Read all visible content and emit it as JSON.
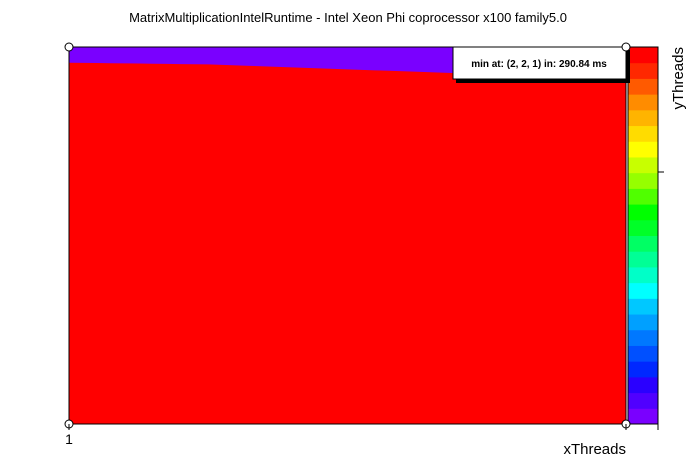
{
  "chart_data": {
    "type": "heatmap",
    "title": "MatrixMultiplicationIntelRuntime - Intel Xeon Phi coprocessor x100 family5.0",
    "xlabel": "xThreads",
    "ylabel": "yThreads",
    "x_ticks": [
      "1"
    ],
    "info_box": "min at: (2, 2, 1) in: 290.84 ms",
    "contour_levels": 20,
    "palette": [
      "#7a00ff",
      "#5000ff",
      "#2a00ff",
      "#0028ff",
      "#0050ff",
      "#0078ff",
      "#00a0ff",
      "#00c8ff",
      "#00ffff",
      "#00ffc8",
      "#00ff96",
      "#00ff64",
      "#00ff28",
      "#00ff00",
      "#50ff00",
      "#96ff00",
      "#c8ff00",
      "#ffff00",
      "#ffdc00",
      "#ffb400",
      "#ff8c00",
      "#ff5a00",
      "#ff2800",
      "#ff0000"
    ],
    "grid": false
  }
}
